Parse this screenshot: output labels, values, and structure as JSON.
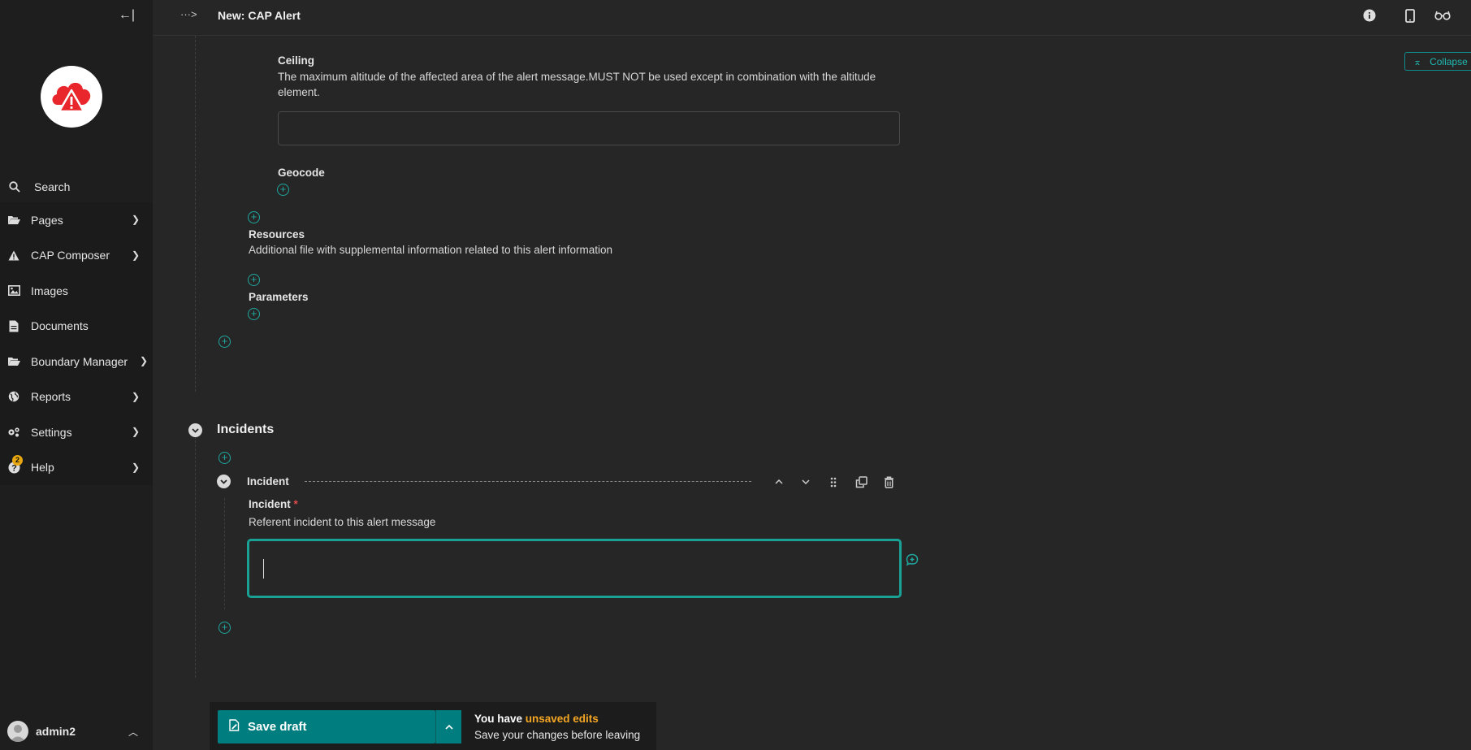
{
  "header": {
    "title": "New: CAP Alert",
    "breadcrumb_toggle": "···>"
  },
  "sidebar": {
    "collapse_glyph": "←|",
    "search_label": "Search",
    "items": [
      {
        "label": "Pages"
      },
      {
        "label": "CAP Composer"
      },
      {
        "label": "Images"
      },
      {
        "label": "Documents"
      },
      {
        "label": "Boundary Manager"
      },
      {
        "label": "Reports"
      },
      {
        "label": "Settings"
      },
      {
        "label": "Help",
        "badge": "2"
      }
    ],
    "user": "admin2"
  },
  "toolbar": {
    "collapse_all_label": "Collapse"
  },
  "form": {
    "ceiling": {
      "label": "Ceiling",
      "help": "The maximum altitude of the affected area of the alert message.MUST NOT be used except in combination with the altitude element.",
      "value": ""
    },
    "geocode": {
      "label": "Geocode"
    },
    "resources": {
      "label": "Resources",
      "help": "Additional file with supplemental information related to this alert information"
    },
    "parameters": {
      "label": "Parameters"
    },
    "incidents": {
      "title": "Incidents",
      "block_title": "Incident",
      "field_label": "Incident",
      "required_mark": "*",
      "help": "Referent incident to this alert message",
      "value": ""
    }
  },
  "footer": {
    "save_label": "Save draft",
    "notice_prefix": "You have ",
    "notice_highlight": "unsaved edits",
    "notice_sub": "Save your changes before leaving"
  },
  "colors": {
    "accent": "#1fa89f",
    "save_button": "#007d7e",
    "warning": "#f5a623",
    "logo_red": "#e8262b"
  }
}
